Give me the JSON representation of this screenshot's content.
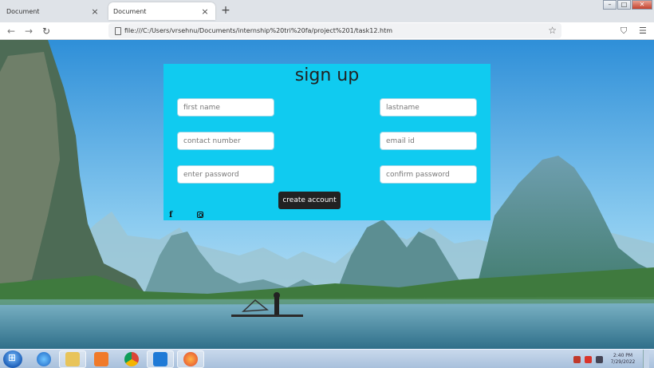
{
  "browser": {
    "tabs": [
      {
        "title": "Document",
        "active": false
      },
      {
        "title": "Document",
        "active": true
      }
    ],
    "new_tab": "+",
    "close_glyph": "×",
    "window_buttons": {
      "minimize": "–",
      "maximize": "□",
      "close": "✕"
    },
    "url": "file:///C:/Users/vrsehnu/Documents/internship%20tri%20fa/project%201/task12.htm",
    "nav": {
      "back": "←",
      "forward": "→",
      "reload": "↻"
    },
    "bookmark_icon": "star-icon",
    "toolbar_icons": [
      "pocket-icon",
      "menu-icon"
    ]
  },
  "form": {
    "title": "sign up",
    "fields": {
      "first_name": "first name",
      "last_name": "lastname",
      "contact": "contact number",
      "email": "email id",
      "password": "enter password",
      "confirm": "confirm password"
    },
    "submit": "create account",
    "social_icons": [
      "facebook-icon",
      "instagram-icon"
    ]
  },
  "taskbar": {
    "apps": [
      "internet-explorer-icon",
      "file-explorer-icon",
      "media-player-icon",
      "chrome-icon",
      "vscode-icon",
      "firefox-icon"
    ],
    "clock_time": "2:40 PM",
    "clock_date": "7/29/2022"
  },
  "colors": {
    "panel": "#10cbf0",
    "button": "#222222",
    "sky": "#3a9ee0"
  }
}
